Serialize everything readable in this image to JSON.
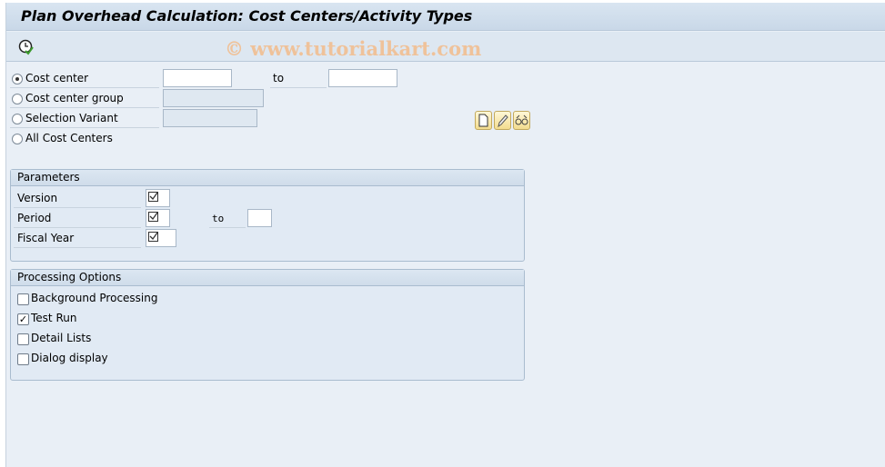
{
  "title": "Plan Overhead Calculation: Cost Centers/Activity Types",
  "toolbar": {
    "execute_icon": "execute-clock-icon",
    "watermark": "© www.tutorialkart.com"
  },
  "selection": {
    "options": [
      {
        "label": "Cost center",
        "selected": true
      },
      {
        "label": "Cost center group",
        "selected": false
      },
      {
        "label": "Selection Variant",
        "selected": false
      },
      {
        "label": "All Cost Centers",
        "selected": false
      }
    ],
    "cost_center_from": "",
    "to_label": "to",
    "cost_center_to": "",
    "variant_buttons": [
      "create-icon",
      "edit-icon",
      "display-icon"
    ]
  },
  "parameters": {
    "header": "Parameters",
    "version_label": "Version",
    "period_label": "Period",
    "period_to_label": "to",
    "fiscal_year_label": "Fiscal Year"
  },
  "processing": {
    "header": "Processing Options",
    "options": [
      {
        "label": "Background Processing",
        "checked": false
      },
      {
        "label": "Test Run",
        "checked": true
      },
      {
        "label": "Detail Lists",
        "checked": false
      },
      {
        "label": "Dialog display",
        "checked": false
      }
    ]
  }
}
